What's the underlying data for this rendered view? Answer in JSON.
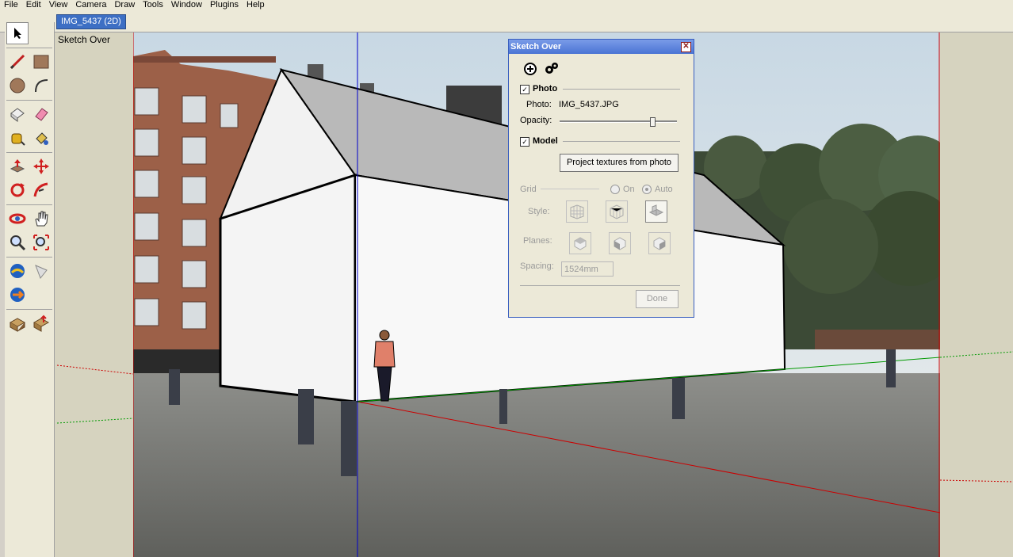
{
  "menu": [
    "File",
    "Edit",
    "View",
    "Camera",
    "Draw",
    "Tools",
    "Window",
    "Plugins",
    "Help"
  ],
  "tab": {
    "label": "IMG_5437 (2D)"
  },
  "scene_label": "Sketch Over",
  "dialog": {
    "title": "Sketch Over",
    "photo_section": "Photo",
    "photo_label": "Photo:",
    "photo_file": "IMG_5437.JPG",
    "opacity_label": "Opacity:",
    "opacity_value": 0.79,
    "model_section": "Model",
    "project_button": "Project textures from photo",
    "grid_label": "Grid",
    "grid_on": "On",
    "grid_auto": "Auto",
    "style_label": "Style:",
    "planes_label": "Planes:",
    "spacing_label": "Spacing:",
    "spacing_value": "1524mm",
    "done_button": "Done",
    "check_mark": "✓"
  },
  "colors": {
    "axis_red": "#cc0000",
    "axis_green": "#009900",
    "axis_blue": "#0000cc",
    "selection": "#3d6fc4"
  }
}
